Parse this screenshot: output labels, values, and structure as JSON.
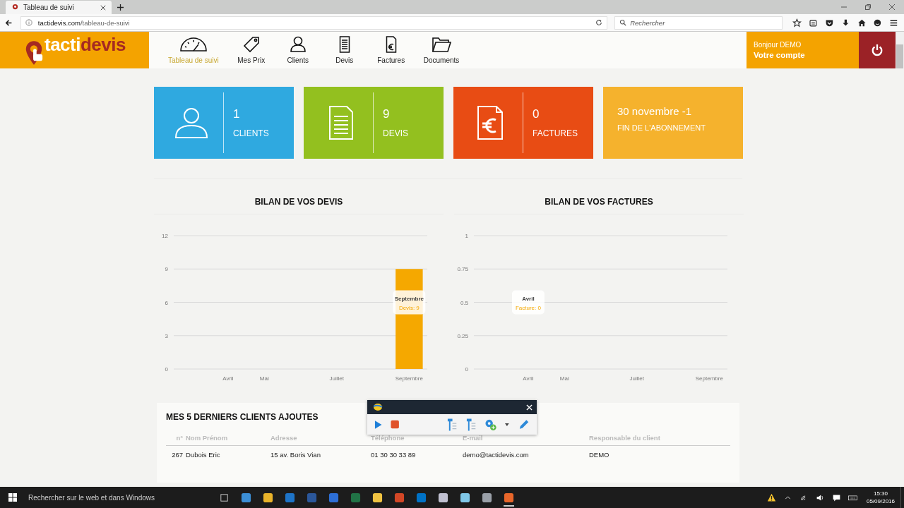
{
  "browser": {
    "tab_title": "Tableau de suivi",
    "url_host": "tactidevis.com",
    "url_path": "/tableau-de-suivi",
    "search_placeholder": "Rechercher"
  },
  "header": {
    "logo": {
      "part1": "tacti",
      "part2": "devis"
    },
    "nav": [
      {
        "label": "Tableau de suivi",
        "kind": "gauge",
        "selected": true
      },
      {
        "label": "Mes Prix",
        "kind": "tag",
        "selected": false
      },
      {
        "label": "Clients",
        "kind": "person",
        "selected": false
      },
      {
        "label": "Devis",
        "kind": "document",
        "selected": false
      },
      {
        "label": "Factures",
        "kind": "invoice",
        "selected": false
      },
      {
        "label": "Documents",
        "kind": "folder",
        "selected": false
      }
    ],
    "account": {
      "greeting": "Bonjour DEMO",
      "link": "Votre compte"
    }
  },
  "stats": [
    {
      "kind": "person",
      "value": "1",
      "label": "CLIENTS",
      "color": "#2fa9e0"
    },
    {
      "kind": "document",
      "value": "9",
      "label": "DEVIS",
      "color": "#93c01f"
    },
    {
      "kind": "invoice",
      "value": "0",
      "label": "FACTURES",
      "color": "#e84c14"
    },
    {
      "kind": "text",
      "value": "30 novembre -1",
      "label": "FIN DE L'ABONNEMENT",
      "color": "#f5b22d"
    }
  ],
  "charts": [
    {
      "chart_data": {
        "type": "bar",
        "title": "BILAN DE VOS DEVIS",
        "categories": [
          null,
          "Avril",
          "Mai",
          null,
          "Juillet",
          null,
          "Septembre"
        ],
        "ylim": [
          0,
          12
        ],
        "grid": true,
        "yticks": [
          0,
          3,
          6,
          9,
          12
        ],
        "series": [
          {
            "color": "#f5a800",
            "values": [
              null,
              0,
              0,
              0,
              0,
              0,
              9
            ]
          }
        ],
        "annotations": [
          "Septembre",
          "Devis: 9"
        ]
      }
    },
    {
      "chart_data": {
        "type": "bar",
        "title": "BILAN DE VOS FACTURES",
        "categories": [
          null,
          "Avril",
          "Mai",
          null,
          "Juillet",
          null,
          "Septembre"
        ],
        "ylim": [
          0,
          1
        ],
        "grid": true,
        "yticks": [
          0,
          0.25,
          0.5,
          0.75,
          1
        ],
        "series": [
          {
            "color": "#f5a800",
            "values": [
              null,
              0,
              0,
              0,
              0,
              0,
              0
            ]
          }
        ],
        "annotations": [
          "Avril",
          "Facture: 0"
        ]
      }
    }
  ],
  "table": {
    "title": "MES 5 DERNIERS CLIENTS AJOUTES",
    "columns": [
      "n°",
      "Nom Prénom",
      "Adresse",
      "Téléphone",
      "E-mail",
      "Responsable du client"
    ],
    "rows": [
      [
        "267",
        "Dubois Eric",
        "15 av. Boris Vian",
        "01 30 30 33 89",
        "demo@tactidevis.com",
        "DEMO"
      ]
    ]
  },
  "taskbar": {
    "search_placeholder": "Rechercher sur le web et dans Windows",
    "time": "15:30",
    "date": "05/09/2016"
  }
}
